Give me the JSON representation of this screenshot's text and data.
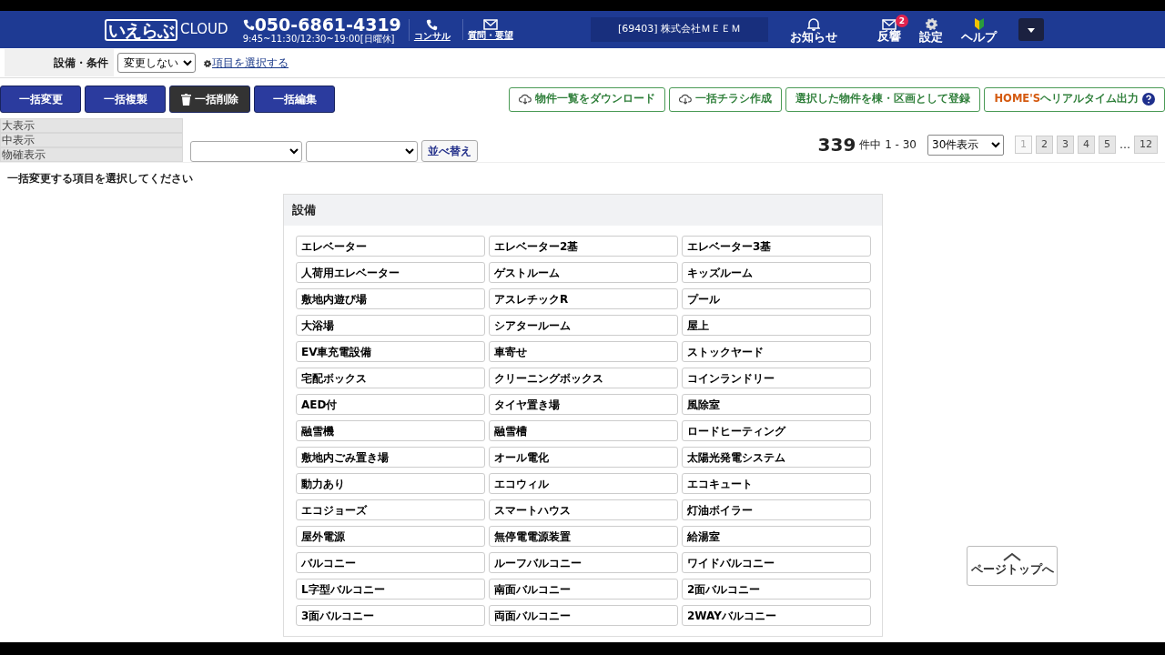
{
  "header": {
    "logo": "いえらぶ",
    "logo_suffix": "CLOUD",
    "phone": "050-6861-4319",
    "hours": "9:45~11:30/12:30~19:00[日曜休]",
    "links": [
      {
        "label": "コンサル",
        "kind": "phone"
      },
      {
        "label": "質問・要望",
        "kind": "mail"
      }
    ],
    "company": "[69403] 株式会社ＭＥＥＭ",
    "icons": [
      {
        "label": "お知らせ",
        "kind": "bell"
      },
      {
        "label": "反響",
        "kind": "mail",
        "badge": "2"
      },
      {
        "label": "設定",
        "kind": "gear"
      },
      {
        "label": "ヘルプ",
        "kind": "leaf"
      }
    ]
  },
  "condition_bar": {
    "label": "設備・条件",
    "select_value": "変更しない",
    "link": "項目を選択する"
  },
  "action_buttons": [
    {
      "label": "一括変更",
      "kind": "primary"
    },
    {
      "label": "一括複製",
      "kind": "primary"
    },
    {
      "label": "一括削除",
      "kind": "delete"
    },
    {
      "label": "一括編集",
      "kind": "primary"
    }
  ],
  "export_buttons": [
    {
      "label": "物件一覧をダウンロード",
      "kind": "download"
    },
    {
      "label": "一括チラシ作成",
      "kind": "download"
    },
    {
      "label": "選択した物件を棟・区画として登録",
      "kind": "plain"
    },
    {
      "label": "**HOME'S**ヘリアルタイム出力",
      "kind": "help"
    }
  ],
  "view_modes": [
    "大表示",
    "中表示",
    "物確表示"
  ],
  "sort": {
    "button": "並べ替え"
  },
  "pagination": {
    "total": "339",
    "range": "件中 1 - 30",
    "per_page": "30件表示",
    "pages": [
      {
        "label": "1",
        "selected": true
      },
      {
        "label": "2",
        "selected": false
      },
      {
        "label": "3",
        "selected": false
      },
      {
        "label": "4",
        "selected": false
      },
      {
        "label": "5",
        "selected": false
      }
    ],
    "ellipsis": "…",
    "last": "12"
  },
  "instruction": "一括変更する項目を選択してください",
  "panel": {
    "title": "設備",
    "items": [
      "エレベーター",
      "エレベーター2基",
      "エレベーター3基",
      "人荷用エレベーター",
      "ゲストルーム",
      "キッズルーム",
      "敷地内遊び場",
      "アスレチックR",
      "プール",
      "大浴場",
      "シアタールーム",
      "屋上",
      "EV車充電設備",
      "車寄せ",
      "ストックヤード",
      "宅配ボックス",
      "クリーニングボックス",
      "コインランドリー",
      "AED付",
      "タイヤ置き場",
      "風除室",
      "融雪機",
      "融雪槽",
      "ロードヒーティング",
      "敷地内ごみ置き場",
      "オール電化",
      "太陽光発電システム",
      "動力あり",
      "エコウィル",
      "エコキュート",
      "エコジョーズ",
      "スマートハウス",
      "灯油ボイラー",
      "屋外電源",
      "無停電電源装置",
      "給湯室",
      "バルコニー",
      "ルーフバルコニー",
      "ワイドバルコニー",
      "L字型バルコニー",
      "南面バルコニー",
      "2面バルコニー",
      "3面バルコニー",
      "両面バルコニー",
      "2WAYバルコニー"
    ]
  },
  "page_top": "ページトップへ"
}
